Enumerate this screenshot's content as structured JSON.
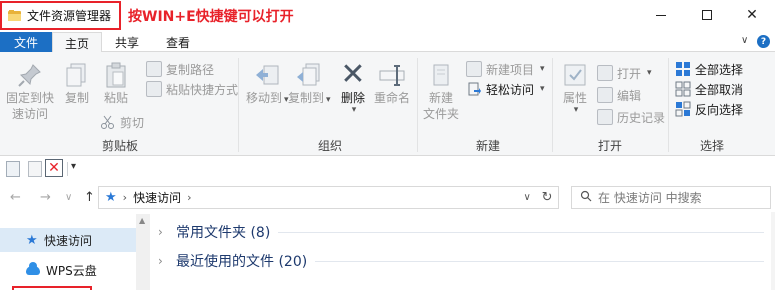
{
  "window": {
    "title": "文件资源管理器",
    "annotation": "按WIN+E快捷键可以打开",
    "minimize": "",
    "maximize": "",
    "close": "✕"
  },
  "ribbon_tabs": {
    "file": "文件",
    "home": "主页",
    "share": "共享",
    "view": "查看"
  },
  "ribbon": {
    "clipboard": {
      "pin_quick_access": [
        "固定到快",
        "速访问"
      ],
      "copy": "复制",
      "paste": "粘贴",
      "copy_path": "复制路径",
      "paste_shortcut": "粘贴快捷方式",
      "cut": "剪切",
      "group_label": "剪贴板"
    },
    "organize": {
      "move_to": "移动到",
      "copy_to": "复制到",
      "delete": "删除",
      "rename": "重命名",
      "group_label": "组织"
    },
    "new": {
      "new_folder": [
        "新建",
        "文件夹"
      ],
      "new_item": "新建项目",
      "easy_access": "轻松访问",
      "group_label": "新建"
    },
    "open": {
      "properties": "属性",
      "open": "打开",
      "edit": "编辑",
      "history": "历史记录",
      "group_label": "打开"
    },
    "select": {
      "select_all": "全部选择",
      "select_none": "全部取消",
      "invert_selection": "反向选择",
      "group_label": "选择"
    }
  },
  "address_bar": {
    "back": "←",
    "forward": "→",
    "recent": "∨",
    "up": "↑",
    "path": "快速访问",
    "separator": "›",
    "dropdown": "∨",
    "refresh": "↻",
    "search_placeholder": "在 快速访问 中搜索"
  },
  "nav_pane": {
    "items": [
      {
        "label": "快速访问",
        "icon": "star-icon",
        "selected": true
      },
      {
        "label": "WPS云盘",
        "icon": "cloud-icon",
        "selected": false
      }
    ]
  },
  "main": {
    "sections": [
      {
        "label": "常用文件夹 (8)",
        "expanded": false
      },
      {
        "label": "最近使用的文件 (20)",
        "expanded": false
      }
    ]
  },
  "colors": {
    "accent": "#1c6fc4",
    "annotation_red": "#e8222a",
    "ribbon_bg": "#f5f6f7",
    "selection_bg": "#dceaf7"
  }
}
